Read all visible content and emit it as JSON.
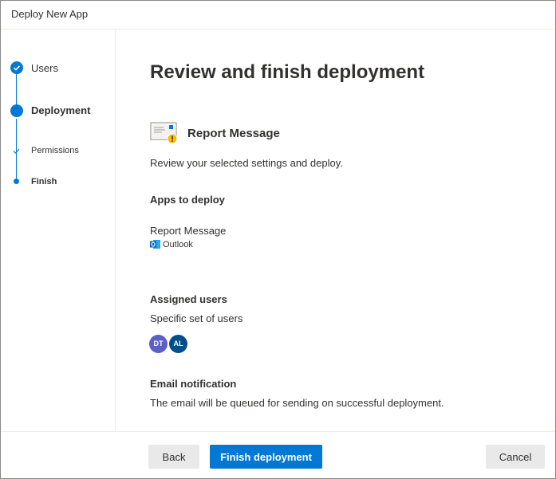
{
  "window": {
    "title": "Deploy New App"
  },
  "steps": [
    {
      "label": "Users",
      "state": "completed"
    },
    {
      "label": "Deployment",
      "state": "current"
    },
    {
      "label": "Permissions",
      "state": "completed-substep"
    },
    {
      "label": "Finish",
      "state": "current-substep"
    }
  ],
  "main": {
    "title": "Review and finish deployment",
    "app_name": "Report Message",
    "subtitle": "Review your selected settings and deploy.",
    "apps_section": {
      "heading": "Apps to deploy",
      "app_name": "Report Message",
      "host": "Outlook"
    },
    "users_section": {
      "heading": "Assigned users",
      "value": "Specific set of users",
      "avatars": [
        {
          "initials": "DT",
          "color": "#5b5fc7"
        },
        {
          "initials": "AL",
          "color": "#004e8c"
        }
      ]
    },
    "email_section": {
      "heading": "Email notification",
      "value": "The email will be queued for sending on successful deployment."
    }
  },
  "footer": {
    "back_label": "Back",
    "finish_label": "Finish deployment",
    "cancel_label": "Cancel"
  },
  "colors": {
    "accent": "#0078d4",
    "text": "#323130",
    "border": "#edebe9"
  }
}
